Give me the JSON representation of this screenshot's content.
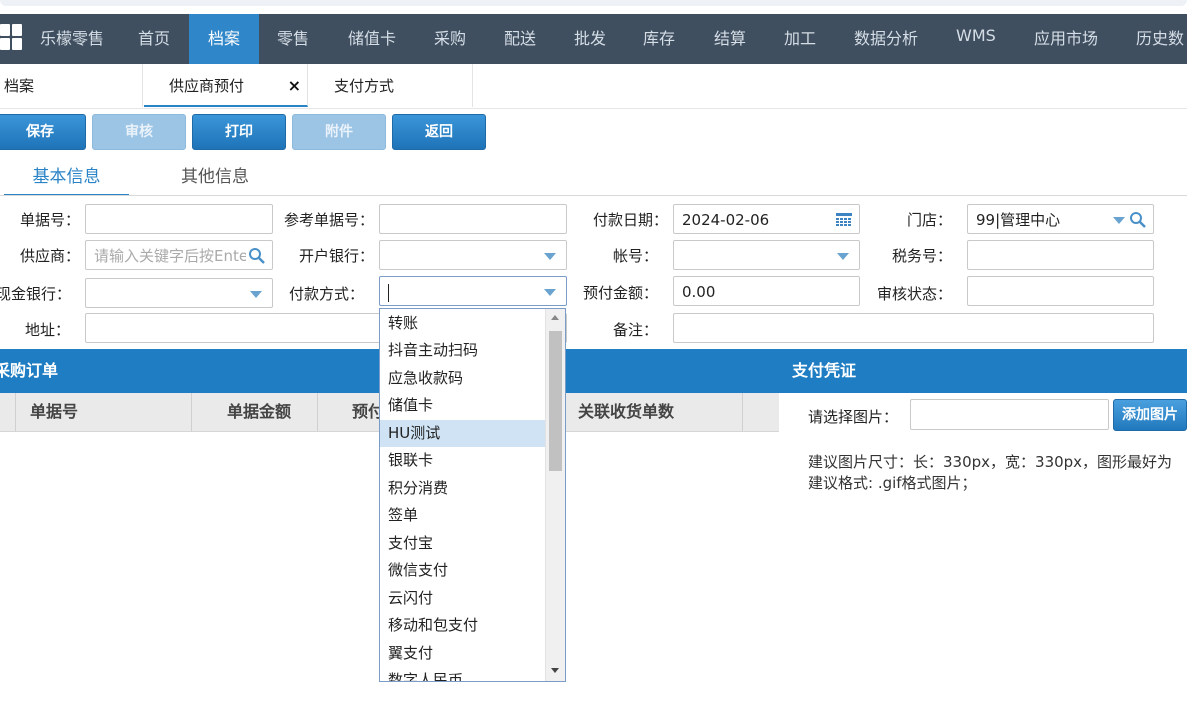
{
  "nav": {
    "brand": "乐檬零售",
    "items": [
      "首页",
      "档案",
      "零售",
      "储值卡",
      "采购",
      "配送",
      "批发",
      "库存",
      "结算",
      "加工",
      "数据分析",
      "WMS",
      "应用市场",
      "历史数"
    ],
    "active": "档案"
  },
  "tabs": [
    "档案",
    "供应商预付",
    "支付方式"
  ],
  "tab_close": "×",
  "toolbar": {
    "save": "保存",
    "audit": "审核",
    "print": "打印",
    "attach": "附件",
    "back": "返回"
  },
  "subtabs": [
    "基本信息",
    "其他信息"
  ],
  "form": {
    "doc_no_label": "单据号：",
    "ref_no_label": "参考单据号：",
    "pay_date_label": "付款日期：",
    "pay_date_value": "2024-02-06",
    "store_label": "门店：",
    "store_value": "99|管理中心",
    "supplier_label": "供应商：",
    "supplier_placeholder": "请输入关键字后按Enter",
    "bank_label": "开户银行：",
    "account_label": "帐号：",
    "tax_label": "税务号：",
    "cash_bank_label": "现金银行：",
    "pay_method_label": "付款方式：",
    "prepay_label": "预付金额：",
    "prepay_value": "0.00",
    "audit_state_label": "审核状态：",
    "address_label": "地址：",
    "remark_label": "备注："
  },
  "orders_panel": {
    "title": "采购订单",
    "columns": [
      "单据号",
      "单据金额",
      "预付",
      "关联收货单数"
    ]
  },
  "voucher_panel": {
    "title": "支付凭证",
    "select_label": "请选择图片：",
    "add_button": "添加图片",
    "hint1": "建议图片尺寸：长：330px，宽：330px，图形最好为",
    "hint2": "建议格式: .gif格式图片；"
  },
  "dropdown": {
    "options": [
      "转账",
      "抖音主动扫码",
      "应急收款码",
      "储值卡",
      "HU测试",
      "银联卡",
      "积分消费",
      "签单",
      "支付宝",
      "微信支付",
      "云闪付",
      "移动和包支付",
      "翼支付",
      "数字人民币"
    ],
    "highlighted": "HU测试"
  }
}
